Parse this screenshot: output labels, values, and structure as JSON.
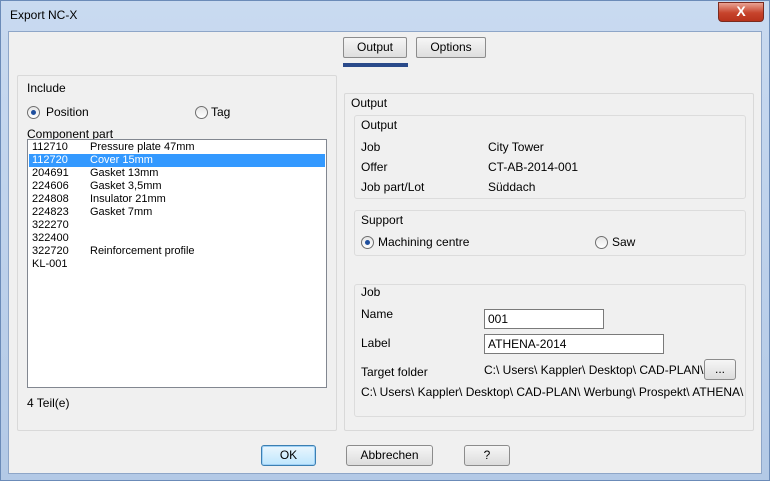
{
  "window": {
    "title": "Export NC-X",
    "close_glyph": "X"
  },
  "tabs": [
    {
      "label": "Output",
      "active": true
    },
    {
      "label": "Options",
      "active": false
    }
  ],
  "left": {
    "include_label": "Include",
    "radio_position": "Position",
    "radio_tag": "Tag",
    "selected_include": "Position",
    "component_label": "Component part",
    "items": [
      {
        "code": "112710",
        "desc": "Pressure plate 47mm",
        "selected": false
      },
      {
        "code": "112720",
        "desc": "Cover 15mm",
        "selected": true
      },
      {
        "code": "204691",
        "desc": "Gasket 13mm",
        "selected": false
      },
      {
        "code": "224606",
        "desc": "Gasket 3,5mm",
        "selected": false
      },
      {
        "code": "224808",
        "desc": "Insulator 21mm",
        "selected": false
      },
      {
        "code": "224823",
        "desc": "Gasket 7mm",
        "selected": false
      },
      {
        "code": "322270",
        "desc": "",
        "selected": false
      },
      {
        "code": "322400",
        "desc": "",
        "selected": false
      },
      {
        "code": "322720",
        "desc": "Reinforcement profile",
        "selected": false
      },
      {
        "code": "KL-001",
        "desc": "",
        "selected": false
      }
    ],
    "count_text": "4 Teil(e)"
  },
  "right": {
    "panel_title": "Output",
    "output_group": {
      "title": "Output",
      "job_label": "Job",
      "job_value": "City Tower",
      "offer_label": "Offer",
      "offer_value": "CT-AB-2014-001",
      "lot_label": "Job part/Lot",
      "lot_value": "Süddach"
    },
    "support_group": {
      "title": "Support",
      "option_machining": "Machining centre",
      "option_saw": "Saw",
      "selected": "Machining centre"
    },
    "job_group": {
      "title": "Job",
      "name_label": "Name",
      "name_value": "001",
      "label_label": "Label",
      "label_value": "ATHENA-2014",
      "target_label": "Target folder",
      "target_value": "C:\\ Users\\ Kappler\\ Desktop\\ CAD-PLAN\\",
      "browse_label": "...",
      "full_path": "C:\\ Users\\ Kappler\\ Desktop\\ CAD-PLAN\\ Werbung\\ Prospekt\\ ATHENA\\"
    }
  },
  "footer": {
    "ok": "OK",
    "cancel": "Abbrechen",
    "help": "?"
  }
}
